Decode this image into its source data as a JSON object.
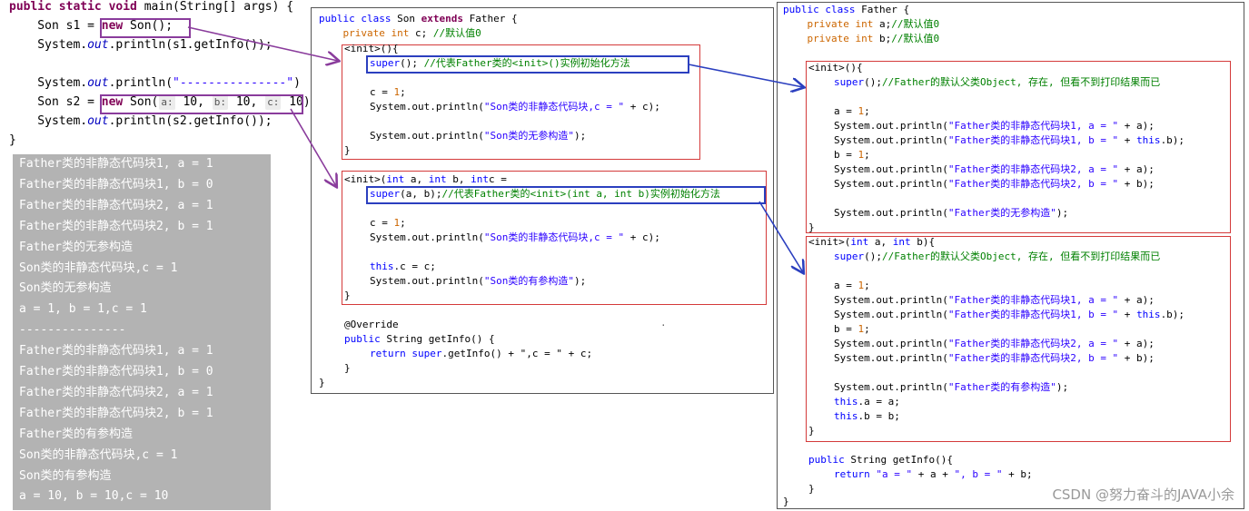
{
  "main_code": {
    "line1_kw": "public static void",
    "line1_rest": " main(String[] args) {",
    "line2_pre": "    Son s1 = ",
    "line2_new": "new",
    "line2_post": " Son();",
    "line3_pre": "    System.",
    "line3_out": "out",
    "line3_post": ".println(s1.getInfo());",
    "line5_pre": "    System.",
    "line5_out": "out",
    "line5_mid": ".println(",
    "line5_str": "\"---------------\"",
    "line5_post": ")",
    "line6_pre": "    Son s2 = ",
    "line6_new": "new",
    "line6_mid": " Son(",
    "hint_a": "a:",
    "val_a": " 10, ",
    "hint_b": "b:",
    "val_b": " 10, ",
    "hint_c": "c:",
    "val_c": " 10);",
    "line7_pre": "    System.",
    "line7_out": "out",
    "line7_post": ".println(s2.getInfo());",
    "line8": "}"
  },
  "console_lines": [
    "Father类的非静态代码块1, a = 1",
    "Father类的非静态代码块1, b = 0",
    "Father类的非静态代码块2, a = 1",
    "Father类的非静态代码块2, b = 1",
    "Father类的无参构造",
    "Son类的非静态代码块,c = 1",
    "Son类的无参构造",
    "a = 1, b = 1,c = 1",
    "---------------",
    "Father类的非静态代码块1, a = 1",
    "Father类的非静态代码块1, b = 0",
    "Father类的非静态代码块2, a = 1",
    "Father类的非静态代码块2, b = 1",
    "Father类的有参构造",
    "Son类的非静态代码块,c = 1",
    "Son类的有参构造",
    "a = 10, b = 10,c = 10"
  ],
  "son": {
    "decl_kw1": "public class",
    "decl_name": " Son ",
    "decl_kw2": "extends",
    "decl_rest": " Father {",
    "field_kw": "    private int",
    "field_rest": " c; ",
    "field_cmt": "//默认值0",
    "init1_sig": "<init>(){",
    "init1_super": "super",
    "init1_super_rest": "(); ",
    "init1_cmt": "//代表Father类的<init>()实例初始化方法",
    "init1_c": "c = ",
    "init1_c_val": "1",
    "init1_c_end": ";",
    "init1_print1_pre": "System.out.println(",
    "init1_print1_str": "\"Son类的非静态代码块,c = \"",
    "init1_print1_post": " + c);",
    "init1_print2_pre": "System.out.println(",
    "init1_print2_str": "\"Son类的无参构造\"",
    "init1_print2_post": ");",
    "close": "}",
    "init2_sig_pre": "<init>(",
    "init2_int1": "int",
    "init2_a": " a, ",
    "init2_int2": "int",
    "init2_b": " b, ",
    "init2_int3": "int",
    "init2_c": "c = ",
    "init2_super": "super",
    "init2_super_rest": "(a, b);",
    "init2_cmt": "//代表Father类的<init>(int a, int b)实例初始化方法",
    "init2_c_val": "1",
    "init2_c_end": ";",
    "init2_print1_pre": "System.out.println(",
    "init2_print1_str": "\"Son类的非静态代码块,c = \"",
    "init2_print1_post": " + c);",
    "init2_this": "this",
    "init2_this_rest": ".c = c;",
    "init2_print2_pre": "System.out.println(",
    "init2_print2_str": "\"Son类的有参构造\"",
    "init2_print2_post": ");",
    "override": "@Override",
    "getinfo_kw": "public",
    "getinfo_rest": " String getInfo() {",
    "return_kw": "return",
    "super_kw": "super",
    "return_rest": ".getInfo() + \",c = \" + c;",
    "brace_inner": "}",
    "brace_outer": "}",
    "dot": "."
  },
  "father": {
    "decl_kw": "public class",
    "decl_rest": " Father {",
    "field_a_kw": "    private int",
    "field_a_rest": " a;",
    "field_a_cmt": "//默认值0",
    "field_b_kw": "    private int",
    "field_b_rest": " b;",
    "field_b_cmt": "//默认值0",
    "init1_sig": "<init>(){",
    "super_kw": "super",
    "super_rest": "();",
    "super_cmt": "//Father的默认父类Object, 存在, 但看不到打印结果而已",
    "a_assign": "a = ",
    "a_val": "1",
    "b_assign": "b = ",
    "b_val": "1",
    "semi": ";",
    "print_pre": "System.out.println(",
    "str_a1": "\"Father类的非静态代码块1, a = \"",
    "str_b1": "\"Father类的非静态代码块1, b = \"",
    "str_a2": "\"Father类的非静态代码块2, a = \"",
    "str_b2": "\"Father类的非静态代码块2, b = \"",
    "plus_a": " + a);",
    "plus_this": " + ",
    "this_kw": "this",
    "this_b": ".b);",
    "plus_b": " + b);",
    "str_noarg": "\"Father类的无参构造\"",
    "str_arg": "\"Father类的有参构造\"",
    "end_paren": ");",
    "close": "}",
    "init2_sig_pre": "<init>(",
    "int_kw": "int",
    "init2_a": " a, ",
    "init2_b": " b){",
    "this_a_rest": ".a = a;",
    "this_b_rest": ".b = b;",
    "getinfo_kw": "public",
    "getinfo_rest": " String getInfo(){",
    "return_kw": "return",
    "return_str1": "\"a = \"",
    "return_mid": " + a + ",
    "return_str2": "\", b = \"",
    "return_end": " + b;",
    "brace_inner": "}",
    "brace_outer": "}"
  },
  "watermark": "CSDN @努力奋斗的JAVA小余",
  "colors": {
    "purple": "#8a3c9c",
    "red": "#d43a3a",
    "blue": "#2b3fbf",
    "console_bg": "#b3b3b3"
  }
}
